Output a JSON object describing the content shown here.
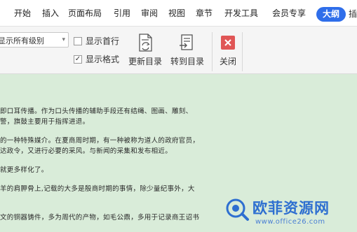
{
  "tabs": [
    {
      "label": "开始"
    },
    {
      "label": "插入"
    },
    {
      "label": "页面布局"
    },
    {
      "label": "引用"
    },
    {
      "label": "审阅"
    },
    {
      "label": "视图"
    },
    {
      "label": "章节"
    },
    {
      "label": "开发工具"
    },
    {
      "label": "会员专享"
    },
    {
      "label": "大纲",
      "active": true
    }
  ],
  "tab_cut_label": "插",
  "ribbon": {
    "level_select": {
      "value": "显示所有级别"
    },
    "show_first_line": {
      "label": "显示首行",
      "checked": false
    },
    "show_format": {
      "label": "显示格式",
      "checked": true,
      "check_mark": "✓"
    },
    "update_toc": {
      "label": "更新目录",
      "icon": "update-toc-icon"
    },
    "goto_toc": {
      "label": "转到目录",
      "icon": "goto-toc-icon"
    },
    "close": {
      "label": "关闭",
      "icon": "close-icon",
      "color": "#e05656"
    }
  },
  "document": {
    "lines": [
      "即口耳传播。作为口头传播的辅助手段还有结绳、图画、雕刻、",
      "警，旗鼓主要用于指挥进退。",
      "的一种特殊媒介。在夏商周时期，有一种被称为道人的政府官员，",
      "达政令，又进行必要的采风。与新闻的采集和发布相近。",
      "就更多样化了。",
      "羊的肩胛骨上,记载的大多是殷商时期的事情，除少量纪事外，大",
      "文的铜器铸件，多为周代的产物，如毛公鼎，多用于记录商王诏书"
    ]
  },
  "watermark": {
    "title": "欧菲资源网",
    "url": "www.office26.com"
  },
  "colors": {
    "doc_background": "#d9ecd9",
    "active_tab": "#2f6eea",
    "watermark": "#2e6fd0"
  }
}
